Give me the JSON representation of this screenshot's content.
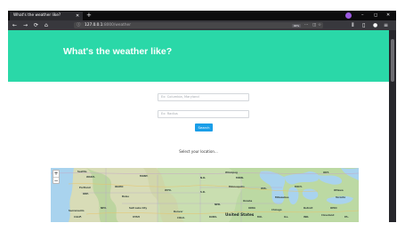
{
  "browser": {
    "tab_title": "What's the weather like?",
    "tab_close": "✕",
    "new_tab": "+",
    "url_host": "127.0.0.1",
    "url_rest": ":8000/weather",
    "url_badge": "90%",
    "controls": {
      "minimize": "–",
      "maximize": "◻",
      "close": "✕"
    },
    "nav_icons": {
      "back": "←",
      "forward": "→",
      "reload": "⟳",
      "home": "⌂",
      "info": "ⓘ",
      "lock": "🔒",
      "menu_dots": "···",
      "pocket": "◫",
      "star": "☆",
      "library": "⫴",
      "sidebar": "▯",
      "account": "●",
      "hamburger": "≡"
    }
  },
  "page": {
    "title": "What's the weather like?",
    "city_placeholder": "Ex: Columbia, Maryland",
    "radius_placeholder": "Ex: Radius",
    "search_label": "Search",
    "prompt": "Select your location..."
  },
  "map": {
    "zoom_in": "+",
    "zoom_out": "−",
    "labels": {
      "country": "United States",
      "wash": "WASH.",
      "ore": "ORE.",
      "idaho": "IDAHO",
      "mont": "MONT.",
      "wyo": "WYO.",
      "nev": "NEV.",
      "utah": "UTAH",
      "colo": "COLO.",
      "nd": "N.D.",
      "sd": "S.D.",
      "neb": "NEB.",
      "kans": "KANS.",
      "minn": "MINN.",
      "iowa": "IOWA",
      "wis": "WIS.",
      "mich": "MICH.",
      "ill": "ILL.",
      "ind": "IND.",
      "ohio": "OHIO",
      "mo": "MO.",
      "pa": "PA.",
      "calif": "CALIF.",
      "ont": "ONT.",
      "seattle": "Seattle",
      "portland": "Portland",
      "boise": "Boise",
      "salt_lake": "Salt Lake City",
      "denver": "Denver",
      "minneapolis": "Minneapolis",
      "chicago": "Chicago",
      "detroit": "Detroit",
      "toronto": "Toronto",
      "ottawa": "Ottawa",
      "winnipeg": "Winnipeg",
      "omaha": "Omaha",
      "sacramento": "Sacramento",
      "cleveland": "Cleveland",
      "milwaukee": "Milwaukee"
    }
  },
  "colors": {
    "hero": "#2ad8a8",
    "button": "#1a9ee8",
    "browser_dark": "#38383d"
  }
}
